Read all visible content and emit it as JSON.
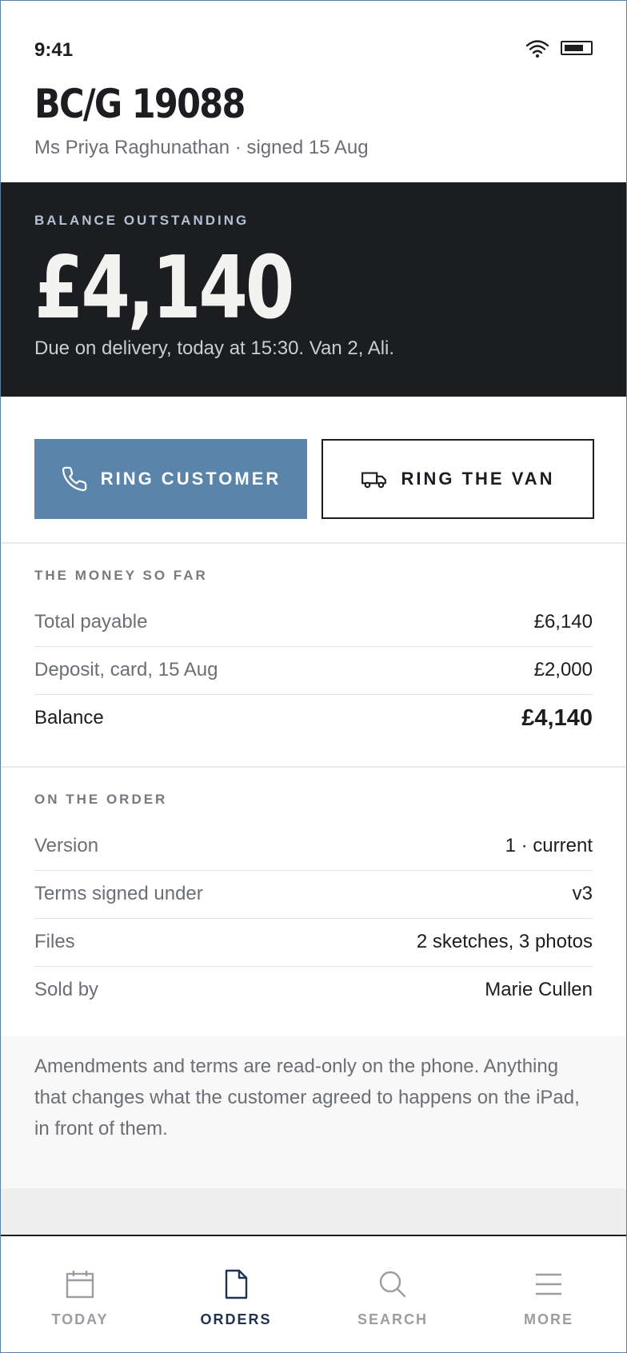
{
  "status_bar": {
    "time": "9:41"
  },
  "header": {
    "title": "BC/G 19088",
    "subtitle": "Ms Priya Raghunathan · signed 15 Aug"
  },
  "balance": {
    "label": "BALANCE OUTSTANDING",
    "amount": "£4,140",
    "note": "Due on delivery, today at 15:30. Van 2, Ali."
  },
  "actions": {
    "ring_customer": "RING CUSTOMER",
    "ring_van": "RING THE VAN"
  },
  "money": {
    "heading": "THE MONEY SO FAR",
    "rows": [
      {
        "label": "Total payable",
        "value": "£6,140"
      },
      {
        "label": "Deposit, card, 15 Aug",
        "value": "£2,000"
      },
      {
        "label": "Balance",
        "value": "£4,140"
      }
    ]
  },
  "order": {
    "heading": "ON THE ORDER",
    "rows": [
      {
        "label": "Version",
        "value": "1 · current"
      },
      {
        "label": "Terms signed under",
        "value": "v3"
      },
      {
        "label": "Files",
        "value": "2 sketches, 3 photos"
      },
      {
        "label": "Sold by",
        "value": "Marie Cullen"
      }
    ]
  },
  "notice": "Amendments and terms are read-only on the phone. Anything that changes what the customer agreed to happens on the iPad, in front of them.",
  "tabs": [
    {
      "label": "TODAY",
      "icon": "calendar-icon",
      "active": false
    },
    {
      "label": "ORDERS",
      "icon": "document-icon",
      "active": true
    },
    {
      "label": "SEARCH",
      "icon": "search-icon",
      "active": false
    },
    {
      "label": "MORE",
      "icon": "menu-icon",
      "active": false
    }
  ],
  "colors": {
    "accent": "#5b84aa",
    "hero_background": "#1c1d20",
    "active_tab": "#1f3250",
    "inactive_tab": "#9b9da1"
  }
}
